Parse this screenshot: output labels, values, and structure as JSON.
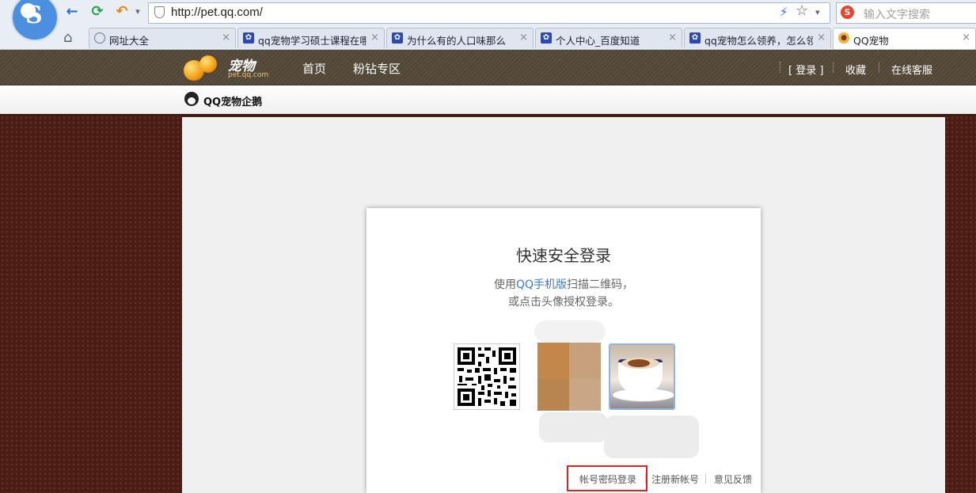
{
  "browser": {
    "logo_letter": "S",
    "back_icon": "←",
    "refresh_icon": "⟳",
    "undo_icon": "↶",
    "address": "http://pet.qq.com/",
    "lightning_icon": "⚡",
    "star_icon": "☆",
    "dropdown_icon": "▾",
    "search_placeholder": "输入文字搜索",
    "search_logo": "S",
    "home_icon": "⌂",
    "close_glyph": "×",
    "tabs": [
      {
        "title": "网址大全",
        "icon": "globe-icon"
      },
      {
        "title": "qq宠物学习硕士课程在哪",
        "icon": "paw-icon"
      },
      {
        "title": "为什么有的人口味那么",
        "icon": "paw-icon"
      },
      {
        "title": "个人中心_百度知道",
        "icon": "paw-icon"
      },
      {
        "title": "qq宠物怎么领养，怎么领",
        "icon": "paw-icon"
      },
      {
        "title": "QQ宠物",
        "icon": "pet-icon",
        "active": true
      }
    ]
  },
  "site": {
    "logo_text": "宠物",
    "logo_sub": "pet.qq.com",
    "nav": [
      "首页",
      "粉钻专区"
    ],
    "login": "[ 登录 ]",
    "favorite": "收藏",
    "service": "在线客服",
    "sub_title": "QQ宠物企鹅"
  },
  "login_panel": {
    "title": "快速安全登录",
    "desc_prefix": "使用",
    "desc_highlight": "QQ手机版",
    "desc_suffix": "扫描二维码，",
    "desc_line2": "或点击头像授权登录。",
    "footer": {
      "account_login": "帐号密码登录",
      "register": "注册新帐号",
      "feedback": "意见反馈"
    }
  },
  "colors": {
    "link_blue": "#3a7bd5",
    "highlight_red": "#e02020",
    "page_bg": "#4a1d15"
  }
}
